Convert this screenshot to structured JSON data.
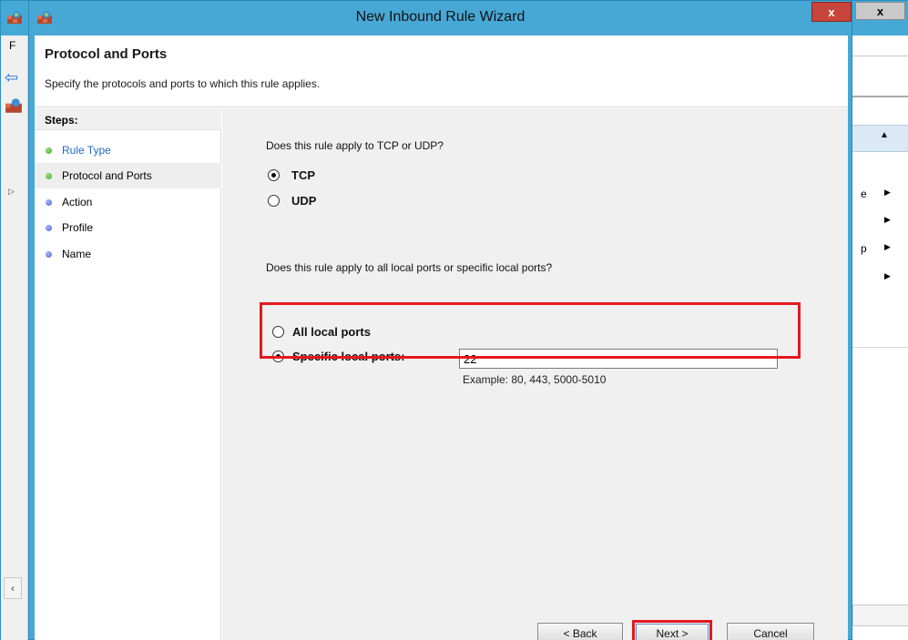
{
  "background_window": {
    "menu_initial": "F",
    "close_label": "x",
    "actions": [
      {
        "label": "e"
      },
      {
        "label": ""
      },
      {
        "label": "p"
      },
      {
        "label": ""
      }
    ]
  },
  "wizard": {
    "title": "New Inbound Rule Wizard",
    "close_label": "x",
    "header": {
      "title": "Protocol and Ports",
      "subtitle": "Specify the protocols and ports to which this rule applies."
    },
    "steps": {
      "title": "Steps:",
      "items": [
        {
          "label": "Rule Type",
          "status": "completed"
        },
        {
          "label": "Protocol and Ports",
          "status": "current"
        },
        {
          "label": "Action",
          "status": "pending"
        },
        {
          "label": "Profile",
          "status": "pending"
        },
        {
          "label": "Name",
          "status": "pending"
        }
      ]
    },
    "protocol": {
      "question": "Does this rule apply to TCP or UDP?",
      "options": [
        {
          "label": "TCP",
          "selected": true
        },
        {
          "label": "UDP",
          "selected": false
        }
      ]
    },
    "ports": {
      "question": "Does this rule apply to all local ports or specific local ports?",
      "options": [
        {
          "label": "All local ports",
          "selected": false
        },
        {
          "label": "Specific local ports:",
          "selected": true
        }
      ],
      "value": "22",
      "example": "Example: 80, 443, 5000-5010"
    },
    "buttons": {
      "back": "< Back",
      "next": "Next >",
      "cancel": "Cancel"
    }
  },
  "colors": {
    "accent": "#47a8d6",
    "highlight": "#e5181f",
    "step_completed": "#3aa524",
    "step_pending": "#4f5fd0",
    "link": "#1e69c6"
  }
}
